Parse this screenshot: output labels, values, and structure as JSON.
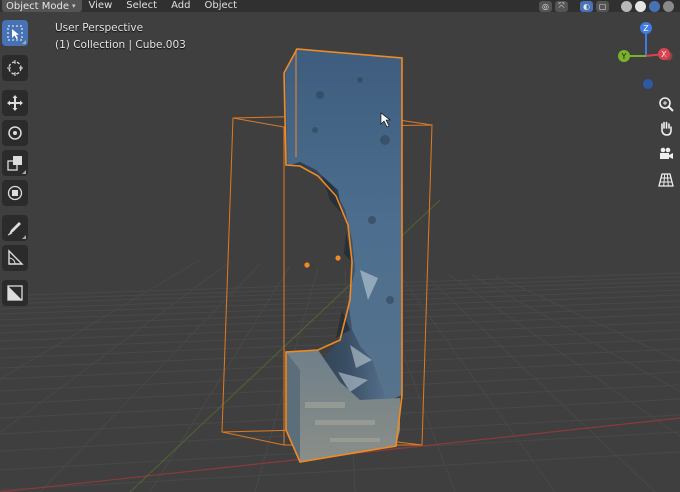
{
  "header": {
    "mode_label": "Object Mode",
    "menus": [
      "View",
      "Select",
      "Add",
      "Object"
    ]
  },
  "viewport": {
    "view_name": "User Perspective",
    "collection_info": "(1) Collection | Cube.003"
  },
  "gizmo": {
    "x_label": "X",
    "y_label": "Y",
    "z_label": "Z"
  },
  "toolbar": {
    "tools": [
      {
        "name": "select-box-tool-icon",
        "active": true
      },
      {
        "name": "cursor-tool-icon",
        "active": false
      },
      {
        "name": "move-tool-icon",
        "active": false
      },
      {
        "name": "rotate-tool-icon",
        "active": false
      },
      {
        "name": "scale-tool-icon",
        "active": false
      },
      {
        "name": "transform-tool-icon",
        "active": false
      },
      {
        "name": "annotate-tool-icon",
        "active": false
      },
      {
        "name": "measure-tool-icon",
        "active": false
      },
      {
        "name": "add-cube-tool-icon",
        "active": false
      }
    ]
  },
  "navigation": [
    "zoom-icon",
    "hand-icon",
    "camera-icon",
    "grid-view-icon"
  ],
  "colors": {
    "accent": "#4772b3",
    "selection_outline": "#f08a24",
    "axis_x": "#d94452",
    "axis_y": "#7ab32a",
    "axis_z": "#3f7be0"
  }
}
